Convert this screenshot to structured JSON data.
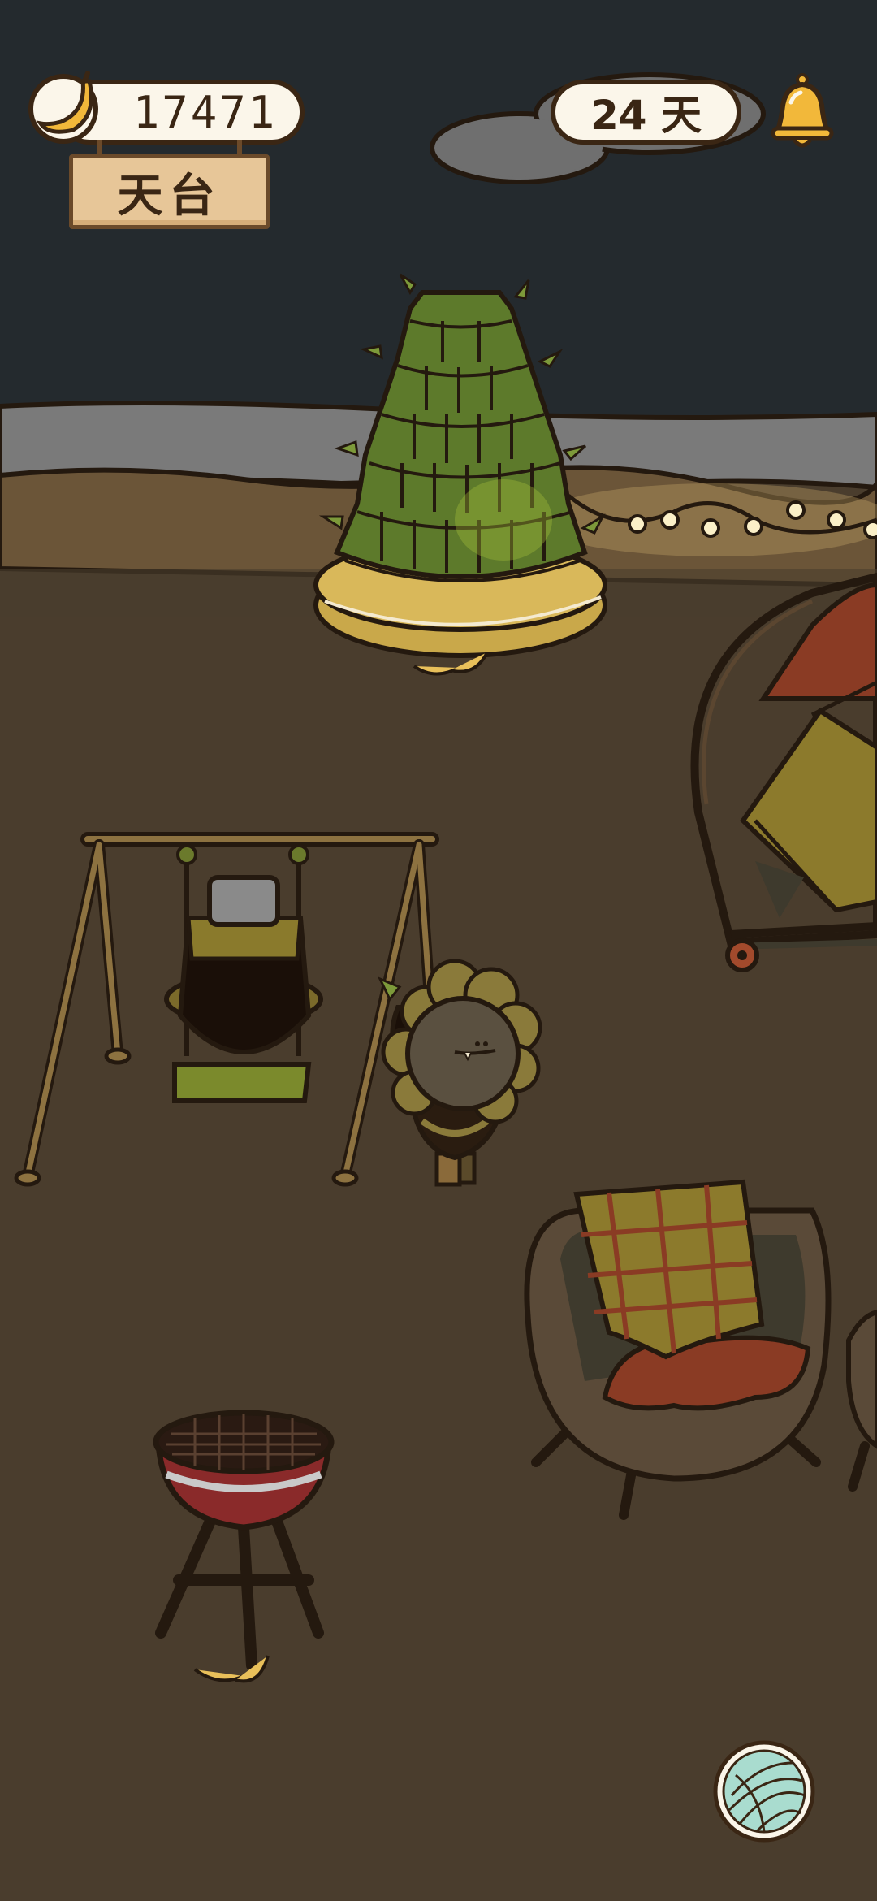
{
  "hud": {
    "banana_count": "17471",
    "days_value": "24",
    "days_unit": "天",
    "location_name": "天台"
  },
  "icons": {
    "currency": "banana-icon",
    "notifications": "bell-icon",
    "menu": "yarn-ball-icon"
  },
  "colors": {
    "night_sky": "#242a2e",
    "ground": "#4a3d2d",
    "hud_pill": "#fbf6ea",
    "outline": "#3a2614",
    "sign_wood": "#e7c698"
  }
}
